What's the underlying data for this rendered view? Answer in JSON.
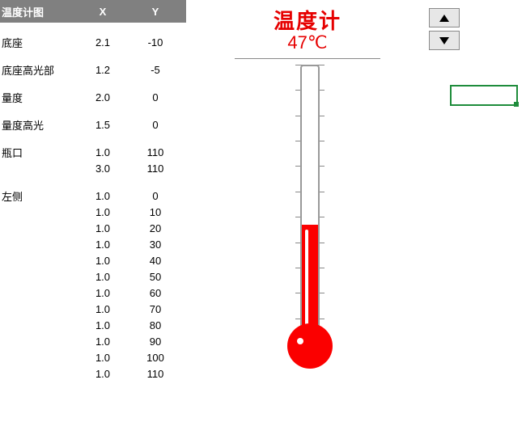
{
  "table": {
    "headers": {
      "name": "温度计图",
      "x": "X",
      "y": "Y"
    },
    "groups": [
      {
        "label": "底座",
        "rows": [
          {
            "x": "2.1",
            "y": "-10"
          }
        ]
      },
      {
        "label": "底座高光部",
        "rows": [
          {
            "x": "1.2",
            "y": "-5"
          }
        ]
      },
      {
        "label": "量度",
        "rows": [
          {
            "x": "2.0",
            "y": "0"
          }
        ]
      },
      {
        "label": "量度高光",
        "rows": [
          {
            "x": "1.5",
            "y": "0"
          }
        ]
      },
      {
        "label": "瓶口",
        "rows": [
          {
            "x": "1.0",
            "y": "110"
          },
          {
            "x": "3.0",
            "y": "110"
          }
        ]
      },
      {
        "label": "左侧",
        "rows": [
          {
            "x": "1.0",
            "y": "0"
          },
          {
            "x": "1.0",
            "y": "10"
          },
          {
            "x": "1.0",
            "y": "20"
          },
          {
            "x": "1.0",
            "y": "30"
          },
          {
            "x": "1.0",
            "y": "40"
          },
          {
            "x": "1.0",
            "y": "50"
          },
          {
            "x": "1.0",
            "y": "60"
          },
          {
            "x": "1.0",
            "y": "70"
          },
          {
            "x": "1.0",
            "y": "80"
          },
          {
            "x": "1.0",
            "y": "90"
          },
          {
            "x": "1.0",
            "y": "100"
          },
          {
            "x": "1.0",
            "y": "110"
          }
        ]
      }
    ]
  },
  "chart_data": {
    "type": "thermometer",
    "title": "温度计",
    "value": 47,
    "unit": "℃",
    "display": "47℃",
    "scale": {
      "min": 0,
      "max": 110,
      "ticks": [
        0,
        10,
        20,
        30,
        40,
        50,
        60,
        70,
        80,
        90,
        100,
        110
      ]
    },
    "colors": {
      "fill": "#fb0000",
      "title": "#e60000"
    }
  }
}
